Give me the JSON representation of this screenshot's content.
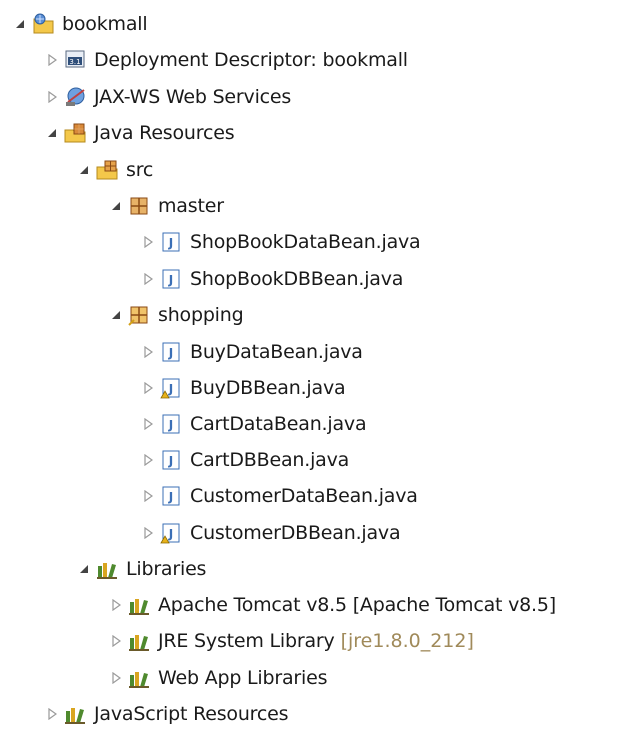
{
  "tree": {
    "project": "bookmall",
    "deployment_descriptor": "Deployment Descriptor: bookmall",
    "jaxws": "JAX-WS Web Services",
    "java_resources": "Java Resources",
    "src": "src",
    "pkg_master": "master",
    "master_files": [
      "ShopBookDataBean.java",
      "ShopBookDBBean.java"
    ],
    "pkg_shopping": "shopping",
    "shopping_files": [
      "BuyDataBean.java",
      "BuyDBBean.java",
      "CartDataBean.java",
      "CartDBBean.java",
      "CustomerDataBean.java",
      "CustomerDBBean.java"
    ],
    "libraries": "Libraries",
    "lib_tomcat": "Apache Tomcat v8.5 [Apache Tomcat v8.5]",
    "lib_jre": "JRE System Library",
    "lib_jre_decoration": "[jre1.8.0_212]",
    "lib_webapp": "Web App Libraries",
    "javascript_resources": "JavaScript Resources"
  },
  "icons": {
    "expanded_twisty": "triangle-down",
    "collapsed_twisty": "triangle-right",
    "java_file": "java-file-icon",
    "package": "package-icon",
    "library": "library-icon"
  },
  "colors": {
    "text": "#1a1a1a",
    "decoration": "#a08a5a",
    "package_brown": "#b06a2a",
    "java_blue": "#3b6fb6",
    "library_green": "#4f8a2e",
    "library_gold": "#d9a520"
  }
}
